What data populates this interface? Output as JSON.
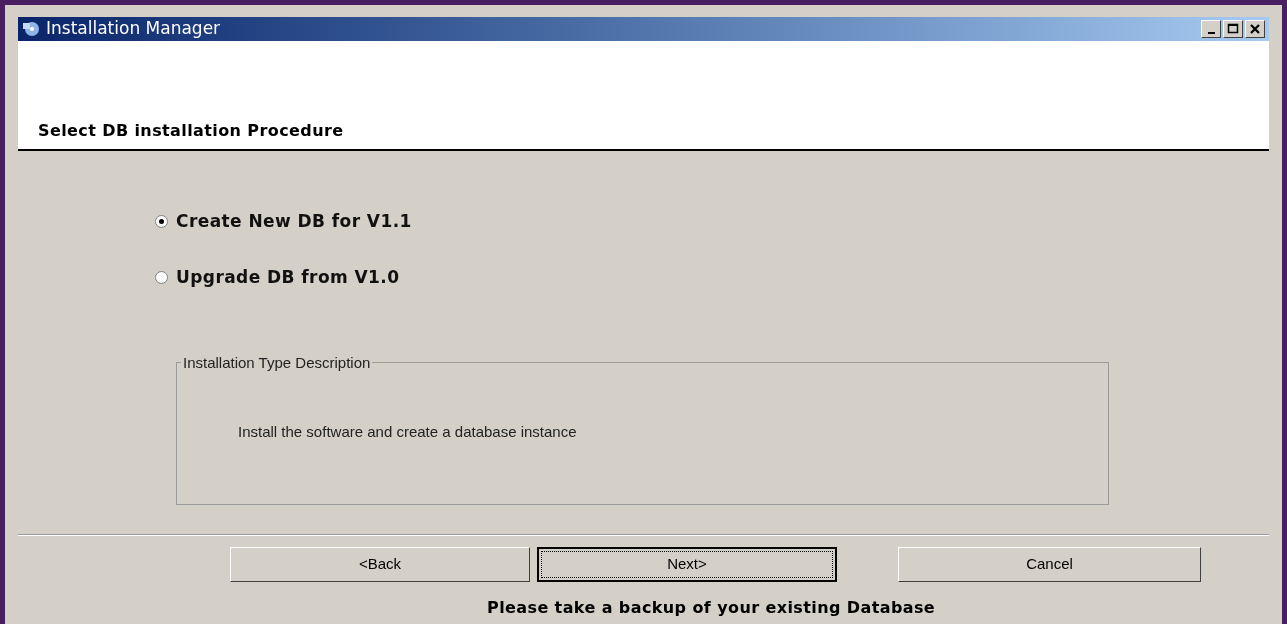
{
  "window": {
    "title": "Installation Manager"
  },
  "header": {
    "title": "Select DB installation Procedure"
  },
  "options": [
    {
      "label": "Create New DB for V1.1",
      "selected": true
    },
    {
      "label": "Upgrade DB from V1.0",
      "selected": false
    }
  ],
  "description_group": {
    "title": "Installation Type Description",
    "text": "Install the software and create a database instance"
  },
  "buttons": [
    {
      "label": "<Back",
      "focused": false
    },
    {
      "label": "Next>",
      "focused": true
    },
    {
      "label": "Cancel",
      "focused": false
    }
  ],
  "footer_note": "Please take a backup of your existing Database"
}
